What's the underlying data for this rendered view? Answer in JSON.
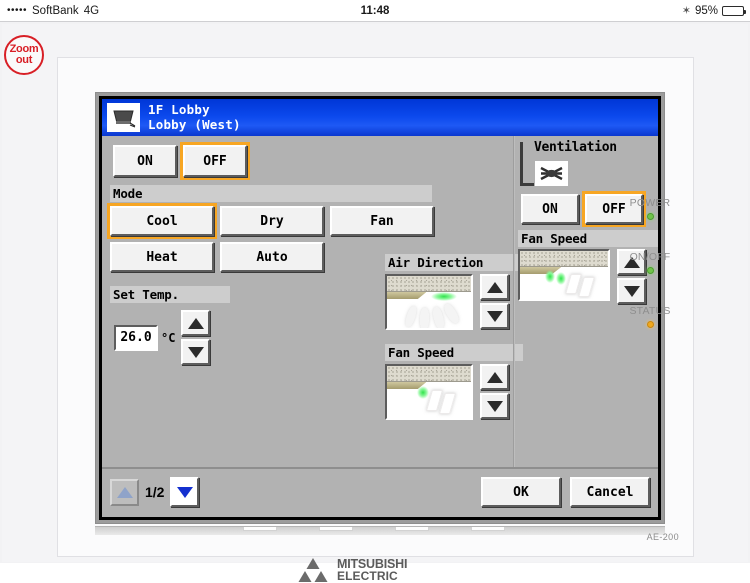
{
  "statusbar": {
    "signal_dots": "•••••",
    "carrier": "SoftBank",
    "network": "4G",
    "time": "11:48",
    "bluetooth_icon": "bluetooth-icon",
    "battery_percent": "95%"
  },
  "overlay": {
    "zoom_out_line1": "Zoom",
    "zoom_out_line2": "out"
  },
  "dialog": {
    "unit_icon": "ceiling-cassette-icon",
    "title_line1": "1F Lobby",
    "title_line2": "Lobby (West)",
    "power": {
      "on_label": "ON",
      "off_label": "OFF",
      "selected": "OFF"
    },
    "mode": {
      "label": "Mode",
      "options": [
        "Cool",
        "Dry",
        "Fan",
        "Heat",
        "Auto"
      ],
      "selected": "Cool"
    },
    "set_temp": {
      "label": "Set Temp.",
      "value": "26.0",
      "unit": "°C",
      "up_icon": "triangle-up-icon",
      "down_icon": "triangle-down-icon"
    },
    "air_direction": {
      "label": "Air Direction",
      "up_icon": "triangle-up-icon",
      "down_icon": "triangle-down-icon"
    },
    "fan_speed": {
      "label": "Fan Speed",
      "up_icon": "triangle-up-icon",
      "down_icon": "triangle-down-icon"
    },
    "ventilation": {
      "title": "Ventilation",
      "icon": "ventilation-fan-icon",
      "on_label": "ON",
      "off_label": "OFF",
      "selected": "OFF",
      "fan_speed_label": "Fan Speed",
      "up_icon": "triangle-up-icon",
      "down_icon": "triangle-down-icon"
    },
    "footer": {
      "page_indicator": "1/2",
      "page_up_icon": "triangle-up-icon",
      "page_down_icon": "triangle-down-icon",
      "ok_label": "OK",
      "cancel_label": "Cancel"
    }
  },
  "device": {
    "brand_line1": "MITSUBISHI",
    "brand_line2": "ELECTRIC",
    "brand_mark": "three-diamonds-icon",
    "model": "AE-200",
    "leds": [
      {
        "label": "POWER",
        "color": "#6fc44a"
      },
      {
        "label": "ON/OFF",
        "color": "#6fc44a"
      },
      {
        "label": "STATUS",
        "color": "#f0a81e"
      }
    ]
  },
  "colors": {
    "accent_orange": "#f7a623",
    "titlebar_blue": "#0b48ec",
    "screen_gray": "#b2b2b2"
  }
}
